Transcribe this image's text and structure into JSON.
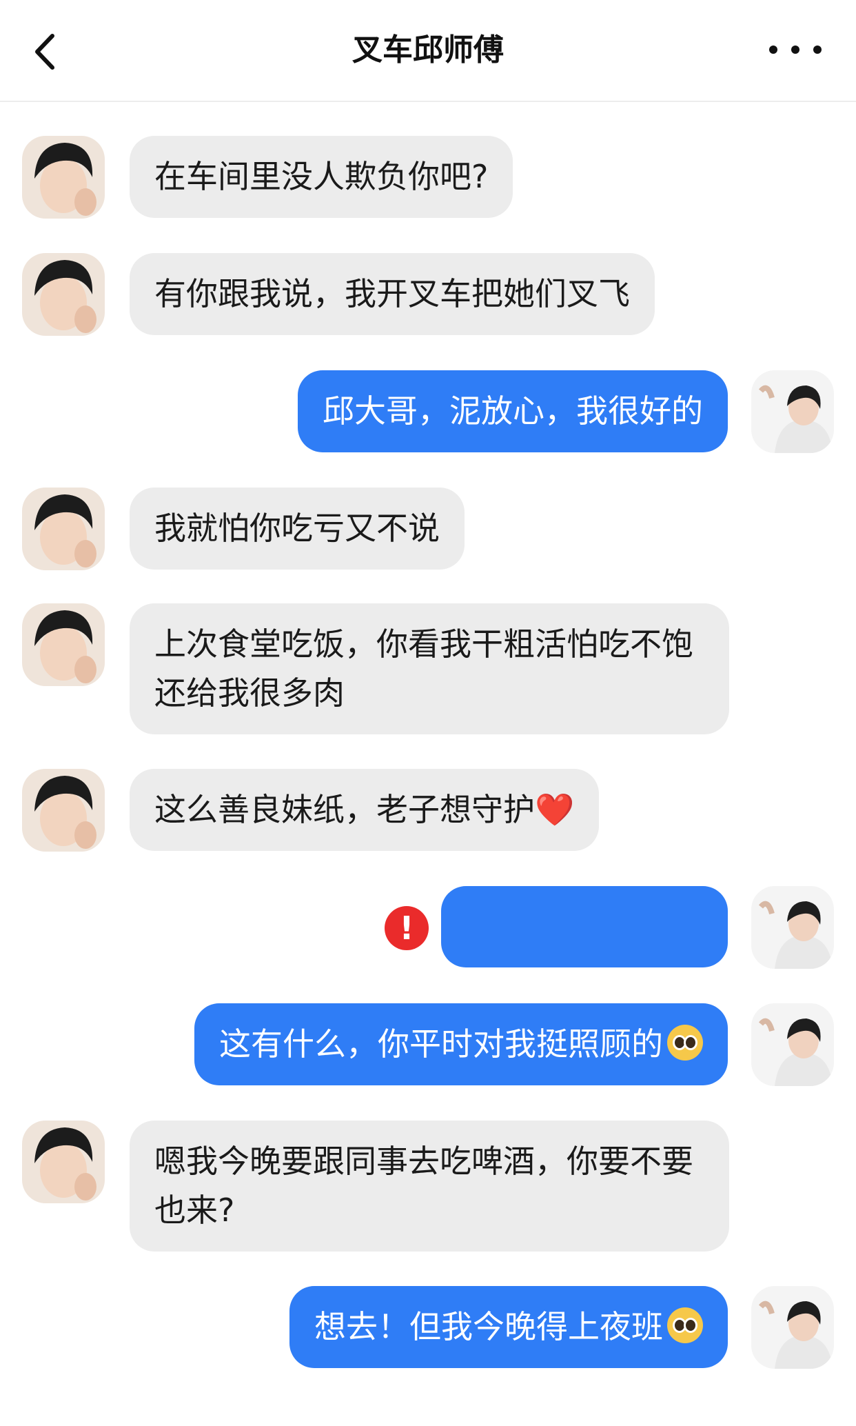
{
  "header": {
    "title": "叉车邱师傅"
  },
  "colors": {
    "sent_bubble": "#2f7df6",
    "received_bubble": "#ececec",
    "error": "#ea2b2b"
  },
  "messages": [
    {
      "side": "left",
      "text": "在车间里没人欺负你吧?"
    },
    {
      "side": "left",
      "text": "有你跟我说，我开叉车把她们叉飞"
    },
    {
      "side": "right",
      "text": "邱大哥，泥放心，我很好的"
    },
    {
      "side": "left",
      "text": "我就怕你吃亏又不说"
    },
    {
      "side": "left",
      "text": "上次食堂吃饭，你看我干粗活怕吃不饱还给我很多肉"
    },
    {
      "side": "left",
      "text": "这么善良妹纸，老子想守护",
      "emoji": "❤️"
    },
    {
      "side": "right",
      "text": "",
      "status": "failed"
    },
    {
      "side": "right",
      "text": "这有什么，你平时对我挺照顾的",
      "emoji": "pleading-face-icon"
    },
    {
      "side": "left",
      "text": "嗯我今晚要跟同事去吃啤酒，你要不要也来?"
    },
    {
      "side": "right",
      "text": "想去！但我今晚得上夜班",
      "emoji": "pleading-face-icon"
    }
  ],
  "icons": {
    "back": "chevron-left-icon",
    "more": "more-dots-icon",
    "error": "error-exclamation-icon"
  },
  "error_mark": "!"
}
